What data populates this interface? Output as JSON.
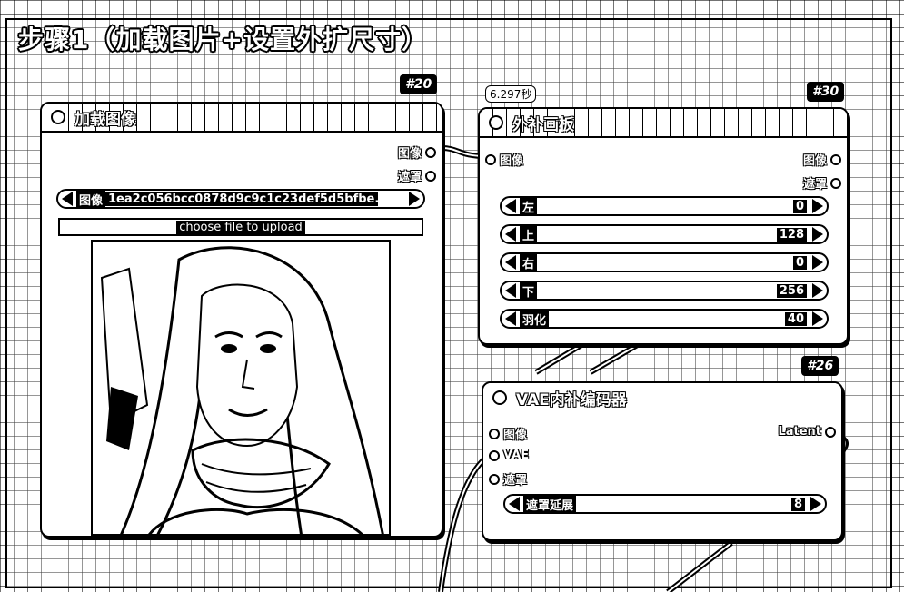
{
  "group": {
    "title": "步骤1（加载图片+设置外扩尺寸）"
  },
  "load_image_node": {
    "id": "#20",
    "title": "加载图像",
    "outputs": [
      "图像",
      "遮罩"
    ],
    "image_widget": {
      "label": "图像",
      "value": "1ea2c056bcc0878d9c9c1c23def5d5bfbe..."
    },
    "upload_label": "choose file to upload"
  },
  "pad_node": {
    "id": "#30",
    "timing": "6.297秒",
    "title": "外补画板",
    "input": "图像",
    "outputs": [
      "图像",
      "遮罩"
    ],
    "widgets": [
      {
        "label": "左",
        "value": "0"
      },
      {
        "label": "上",
        "value": "128"
      },
      {
        "label": "右",
        "value": "0"
      },
      {
        "label": "下",
        "value": "256"
      },
      {
        "label": "羽化",
        "value": "40"
      }
    ]
  },
  "vae_node": {
    "id": "#26",
    "title": "VAE内补编码器",
    "inputs": [
      "图像",
      "VAE",
      "遮罩"
    ],
    "output": "Latent",
    "widget": {
      "label": "遮罩延展",
      "value": "8"
    }
  }
}
